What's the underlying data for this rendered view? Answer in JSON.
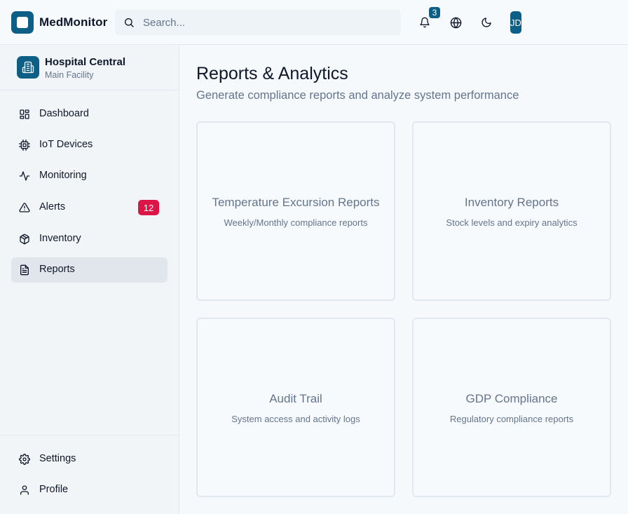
{
  "app": {
    "title": "MedMonitor"
  },
  "header": {
    "search_placeholder": "Search...",
    "notification_count": "3",
    "avatar_initials": "JD",
    "icons": [
      "search-icon",
      "bell-icon",
      "globe-icon",
      "moon-icon"
    ]
  },
  "facility": {
    "name": "Hospital Central",
    "subtitle": "Main Facility",
    "icon": "hospital-building-icon"
  },
  "sidebar": {
    "items": [
      {
        "label": "Dashboard",
        "icon": "dashboard-icon",
        "active": false
      },
      {
        "label": "IoT Devices",
        "icon": "chip-icon",
        "active": false
      },
      {
        "label": "Monitoring",
        "icon": "activity-icon",
        "active": false
      },
      {
        "label": "Alerts",
        "icon": "alert-triangle-icon",
        "active": false,
        "badge": "12"
      },
      {
        "label": "Inventory",
        "icon": "package-icon",
        "active": false
      },
      {
        "label": "Reports",
        "icon": "file-text-icon",
        "active": true
      }
    ],
    "bottom_items": [
      {
        "label": "Settings",
        "icon": "gear-icon"
      },
      {
        "label": "Profile",
        "icon": "user-icon"
      }
    ]
  },
  "main": {
    "title": "Reports & Analytics",
    "subtitle": "Generate compliance reports and analyze system performance",
    "cards": [
      {
        "title": "Temperature Excursion Reports",
        "description": "Weekly/Monthly compliance reports"
      },
      {
        "title": "Inventory Reports",
        "description": "Stock levels and expiry analytics"
      },
      {
        "title": "Audit Trail",
        "description": "System access and activity logs"
      },
      {
        "title": "GDP Compliance",
        "description": "Regulatory compliance reports"
      }
    ]
  },
  "colors": {
    "brand": "#0e5f86",
    "alert_badge": "#dc1547",
    "active_nav": "#e1e6ec"
  }
}
